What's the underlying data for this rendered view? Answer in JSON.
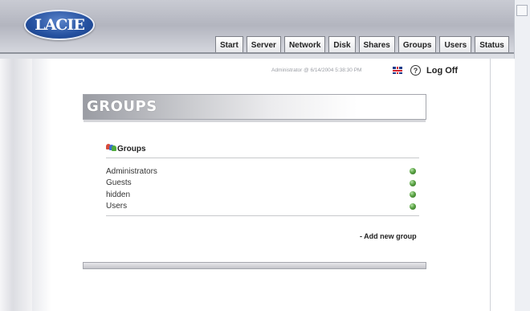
{
  "brand": {
    "logo_text": "LACIE"
  },
  "tabs": [
    "Start",
    "Server",
    "Network",
    "Disk",
    "Shares",
    "Groups",
    "Users",
    "Status"
  ],
  "header": {
    "status_text": "Administrator @ 6/14/2004 5:38:30 PM",
    "logoff_label": "Log Off",
    "help_symbol": "?"
  },
  "page": {
    "title": "GROUPS"
  },
  "section": {
    "title": "Groups",
    "icon": "groups-icon",
    "items": [
      "Administrators",
      "Guests",
      "hidden",
      "Users"
    ],
    "add_link": "- Add new group"
  },
  "colors": {
    "logo_blue": "#24509f",
    "edit_green": "#5aa344"
  }
}
